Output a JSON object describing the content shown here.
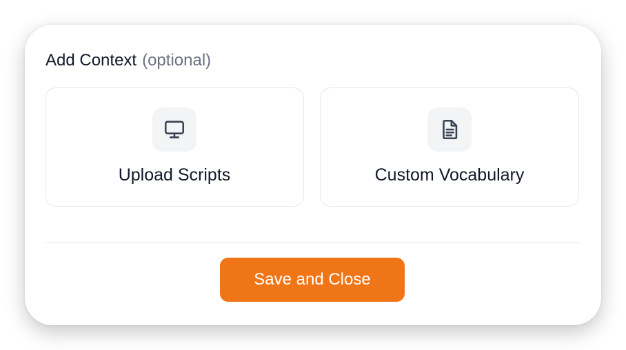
{
  "dialog": {
    "title": "Add Context",
    "title_suffix": "(optional)",
    "options": [
      {
        "label": "Upload Scripts",
        "icon": "monitor-icon"
      },
      {
        "label": "Custom Vocabulary",
        "icon": "document-icon"
      }
    ],
    "save_label": "Save and Close"
  },
  "colors": {
    "accent": "#f07516",
    "text": "#111827",
    "muted": "#6b7280",
    "border": "#e5e7eb",
    "icon_bg": "#f3f4f6"
  }
}
